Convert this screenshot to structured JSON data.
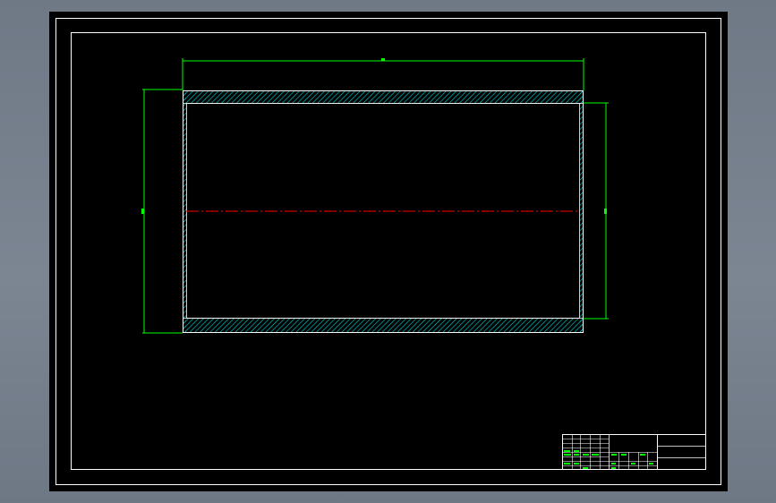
{
  "colors": {
    "viewport_background": "#6e7885",
    "sheet_background": "#000000",
    "frame_line": "#ffffff",
    "dimension_line": "#00ff00",
    "part_outline": "#ffffff",
    "hatch": "#00c8c8",
    "centerline": "#ff0000",
    "title_block_text": "#00ff00"
  },
  "drawing": {
    "section_view": "cylinder-sleeve-section",
    "dimension_text_legible": false
  },
  "title_block": {
    "text_legible": false
  }
}
